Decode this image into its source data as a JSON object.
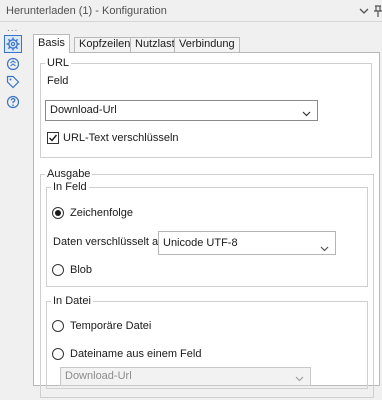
{
  "window": {
    "title": "Herunterladen (1) - Konfiguration"
  },
  "sidebar": {
    "more": "...",
    "items": [
      {
        "name": "configuration",
        "icon": "gear-icon",
        "active": true
      },
      {
        "name": "annotation",
        "icon": "annotation-icon",
        "active": false
      },
      {
        "name": "tags",
        "icon": "tag-icon",
        "active": false
      },
      {
        "name": "help",
        "icon": "help-icon",
        "active": false
      }
    ]
  },
  "tabs": [
    {
      "label": "Basis",
      "active": true
    },
    {
      "label": "Kopfzeilen",
      "active": false
    },
    {
      "label": "Nutzlast",
      "active": false
    },
    {
      "label": "Verbindung",
      "active": false
    }
  ],
  "url_group": {
    "title": "URL",
    "field_label": "Feld",
    "field_value": "Download-Url",
    "encode_label": "URL-Text verschlüsseln",
    "encode_checked": true
  },
  "output_group": {
    "title": "Ausgabe",
    "in_field": {
      "title": "In Feld",
      "string_label": "Zeichenfolge",
      "string_selected": true,
      "encoding_label": "Daten verschlüsselt als",
      "encoding_value": "Unicode UTF-8",
      "blob_label": "Blob",
      "blob_selected": false
    },
    "in_file": {
      "title": "In Datei",
      "temp_label": "Temporäre Datei",
      "temp_selected": false,
      "filename_label": "Dateiname aus einem Feld",
      "filename_selected": false,
      "filename_value": "Download-Url"
    }
  },
  "colors": {
    "accent": "#3a73c4",
    "panel_bg": "#f0f0f0",
    "content_bg": "#ffffff"
  }
}
